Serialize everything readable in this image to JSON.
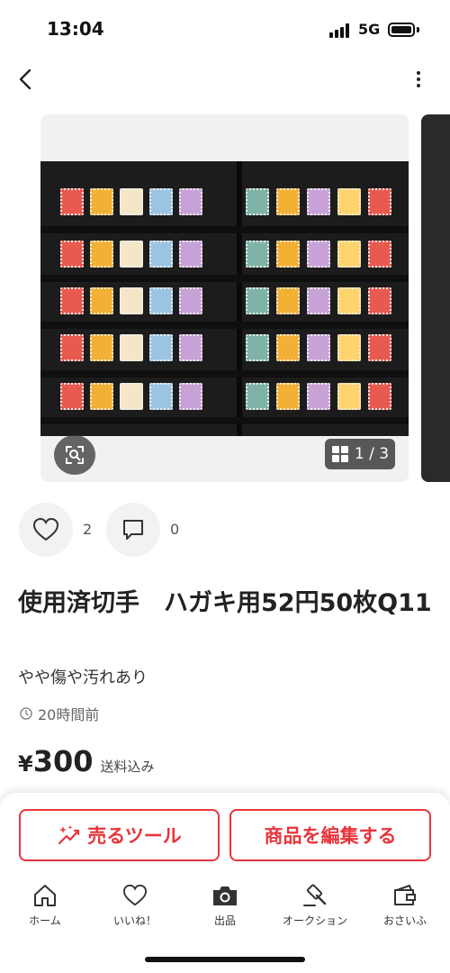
{
  "status_bar": {
    "time": "13:04",
    "network": "5G",
    "battery_level": 1.0
  },
  "header": {
    "back_icon": "chevron-left-icon",
    "more_icon": "more-vertical-icon"
  },
  "gallery": {
    "current_index": "1",
    "separator": "/",
    "total": "3",
    "lens_icon": "visual-search-icon",
    "grid_icon": "grid-icon"
  },
  "actions": {
    "like": {
      "icon": "heart-icon",
      "count": "2"
    },
    "comment": {
      "icon": "comment-icon",
      "count": "0"
    }
  },
  "product": {
    "title": "使用済切手　ハガキ用52円50枚Q11",
    "condition": "やや傷や汚れあり",
    "posted": "20時間前",
    "price_currency": "¥",
    "price": "300",
    "shipping_note": "送料込み"
  },
  "buttons": {
    "sell_tool": "売るツール",
    "edit_item": "商品を編集する"
  },
  "tabs": [
    {
      "label": "ホーム",
      "icon": "home-icon"
    },
    {
      "label": "いいね！",
      "icon": "heart-icon"
    },
    {
      "label": "出品",
      "icon": "camera-icon"
    },
    {
      "label": "オークション",
      "icon": "gavel-icon"
    },
    {
      "label": "おさいふ",
      "icon": "wallet-icon"
    }
  ],
  "colors": {
    "accent": "#e8353b",
    "text": "#222222",
    "muted": "#666666"
  }
}
